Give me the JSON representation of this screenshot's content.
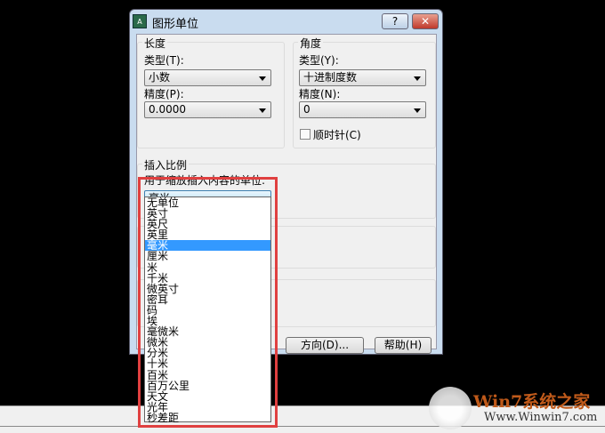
{
  "dialog": {
    "title": "图形单位",
    "help_label": "?",
    "close_label": "✕",
    "icon": "autocad-app-icon"
  },
  "length": {
    "group": "长度",
    "type_label": "类型(T):",
    "type_value": "小数",
    "precision_label": "精度(P):",
    "precision_value": "0.0000"
  },
  "angle": {
    "group": "角度",
    "type_label": "类型(Y):",
    "type_value": "十进制度数",
    "precision_label": "精度(N):",
    "precision_value": "0",
    "clockwise_label": "顺时针(C)",
    "clockwise_checked": false
  },
  "insert": {
    "group": "插入比例",
    "label": "用于缩放插入内容的单位:",
    "value": "毫米",
    "options": [
      "无单位",
      "英寸",
      "英尺",
      "英里",
      "毫米",
      "厘米",
      "米",
      "千米",
      "微英寸",
      "密耳",
      "码",
      "埃",
      "毫微米",
      "微米",
      "分米",
      "十米",
      "百米",
      "百万公里",
      "天文",
      "光年",
      "秒差距"
    ],
    "selected_index": 4
  },
  "buttons": {
    "direction": "方向(D)...",
    "help": "帮助(H)"
  },
  "watermark": {
    "brand": "Win7系统之家",
    "url": "Www.Winwin7.com"
  },
  "colors": {
    "highlight": "#e04040",
    "selection": "#3399ff"
  }
}
